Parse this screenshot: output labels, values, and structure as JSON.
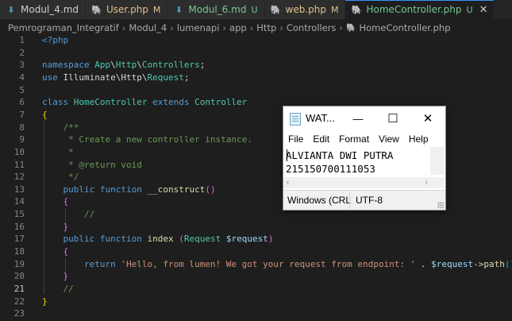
{
  "tabs": [
    {
      "icon": "markdown-icon",
      "label": "Modul_4.md",
      "status": "",
      "state": "normal"
    },
    {
      "icon": "php-icon",
      "label": "User.php",
      "status": "M",
      "state": "modified"
    },
    {
      "icon": "markdown-icon",
      "label": "Modul_6.md",
      "status": "U",
      "state": "untracked"
    },
    {
      "icon": "php-icon",
      "label": "web.php",
      "status": "M",
      "state": "modified"
    },
    {
      "icon": "php-icon",
      "label": "HomeController.php",
      "status": "U",
      "state": "untracked-active",
      "close": "✕"
    }
  ],
  "breadcrumb": [
    "Pemrograman_Integratif",
    "Modul_4",
    "lumenapi",
    "app",
    "Http",
    "Controllers",
    "HomeController.php"
  ],
  "editor": {
    "current_line": 21,
    "lines": [
      {
        "n": "1",
        "t": [
          [
            "tag",
            "<?php"
          ]
        ]
      },
      {
        "n": "2",
        "t": []
      },
      {
        "n": "3",
        "t": [
          [
            "kw",
            "namespace "
          ],
          [
            "ns",
            "App"
          ],
          [
            "p",
            "\\"
          ],
          [
            "ns",
            "Http"
          ],
          [
            "p",
            "\\"
          ],
          [
            "ns",
            "Controllers"
          ],
          [
            "p",
            ";"
          ]
        ]
      },
      {
        "n": "4",
        "t": [
          [
            "kw",
            "use "
          ],
          [
            "p",
            "Illuminate\\Http\\"
          ],
          [
            "ns",
            "Request"
          ],
          [
            "p",
            ";"
          ]
        ]
      },
      {
        "n": "5",
        "t": []
      },
      {
        "n": "6",
        "t": [
          [
            "kw",
            "class "
          ],
          [
            "cls",
            "HomeController "
          ],
          [
            "kw",
            "extends "
          ],
          [
            "cls",
            "Controller"
          ]
        ]
      },
      {
        "n": "7",
        "t": [
          [
            "br1",
            "{"
          ]
        ]
      },
      {
        "n": "8",
        "t": [
          [
            "p",
            "    "
          ],
          [
            "cmt",
            "/**"
          ]
        ]
      },
      {
        "n": "9",
        "t": [
          [
            "p",
            "     "
          ],
          [
            "cmt",
            "* Create a new controller instance."
          ]
        ]
      },
      {
        "n": "10",
        "t": [
          [
            "p",
            "     "
          ],
          [
            "cmt",
            "*"
          ]
        ]
      },
      {
        "n": "11",
        "t": [
          [
            "p",
            "     "
          ],
          [
            "cmt",
            "* @return void"
          ]
        ]
      },
      {
        "n": "12",
        "t": [
          [
            "p",
            "     "
          ],
          [
            "cmt",
            "*/"
          ]
        ]
      },
      {
        "n": "13",
        "t": [
          [
            "p",
            "    "
          ],
          [
            "kw",
            "public function "
          ],
          [
            "fn",
            "__construct"
          ],
          [
            "br2",
            "()"
          ]
        ]
      },
      {
        "n": "14",
        "t": [
          [
            "p",
            "    "
          ],
          [
            "br2",
            "{"
          ]
        ]
      },
      {
        "n": "15",
        "t": [
          [
            "p",
            "        "
          ],
          [
            "cmt",
            "//"
          ]
        ]
      },
      {
        "n": "16",
        "t": [
          [
            "p",
            "    "
          ],
          [
            "br2",
            "}"
          ]
        ]
      },
      {
        "n": "17",
        "t": [
          [
            "p",
            "    "
          ],
          [
            "kw",
            "public function "
          ],
          [
            "fn",
            "index "
          ],
          [
            "br2",
            "("
          ],
          [
            "cls",
            "Request "
          ],
          [
            "var",
            "$request"
          ],
          [
            "br2",
            ")"
          ]
        ]
      },
      {
        "n": "18",
        "t": [
          [
            "p",
            "    "
          ],
          [
            "br2",
            "{"
          ]
        ]
      },
      {
        "n": "19",
        "t": [
          [
            "p",
            "        "
          ],
          [
            "kw",
            "return "
          ],
          [
            "str",
            "'Hello, from lumen! We got your request from endpoint: '"
          ],
          [
            "p",
            " . "
          ],
          [
            "var",
            "$request"
          ],
          [
            "p",
            "->"
          ],
          [
            "fn",
            "path"
          ],
          [
            "br3",
            "()"
          ],
          [
            "p",
            ";"
          ]
        ]
      },
      {
        "n": "20",
        "t": [
          [
            "p",
            "    "
          ],
          [
            "br2",
            "}"
          ]
        ]
      },
      {
        "n": "21",
        "t": [
          [
            "p",
            "    "
          ],
          [
            "cmt",
            "//"
          ]
        ]
      },
      {
        "n": "22",
        "t": [
          [
            "br1",
            "}"
          ]
        ]
      },
      {
        "n": "23",
        "t": []
      }
    ]
  },
  "notepad": {
    "title": "WAT...",
    "buttons": {
      "minimize": "—",
      "maximize": "☐",
      "close": "✕"
    },
    "menu": [
      "File",
      "Edit",
      "Format",
      "View",
      "Help"
    ],
    "text": [
      "ALVIANTA DWI PUTRA",
      "215150700111053"
    ],
    "status_left": "Windows (CRLF)",
    "status_encoding": "UTF-8"
  }
}
